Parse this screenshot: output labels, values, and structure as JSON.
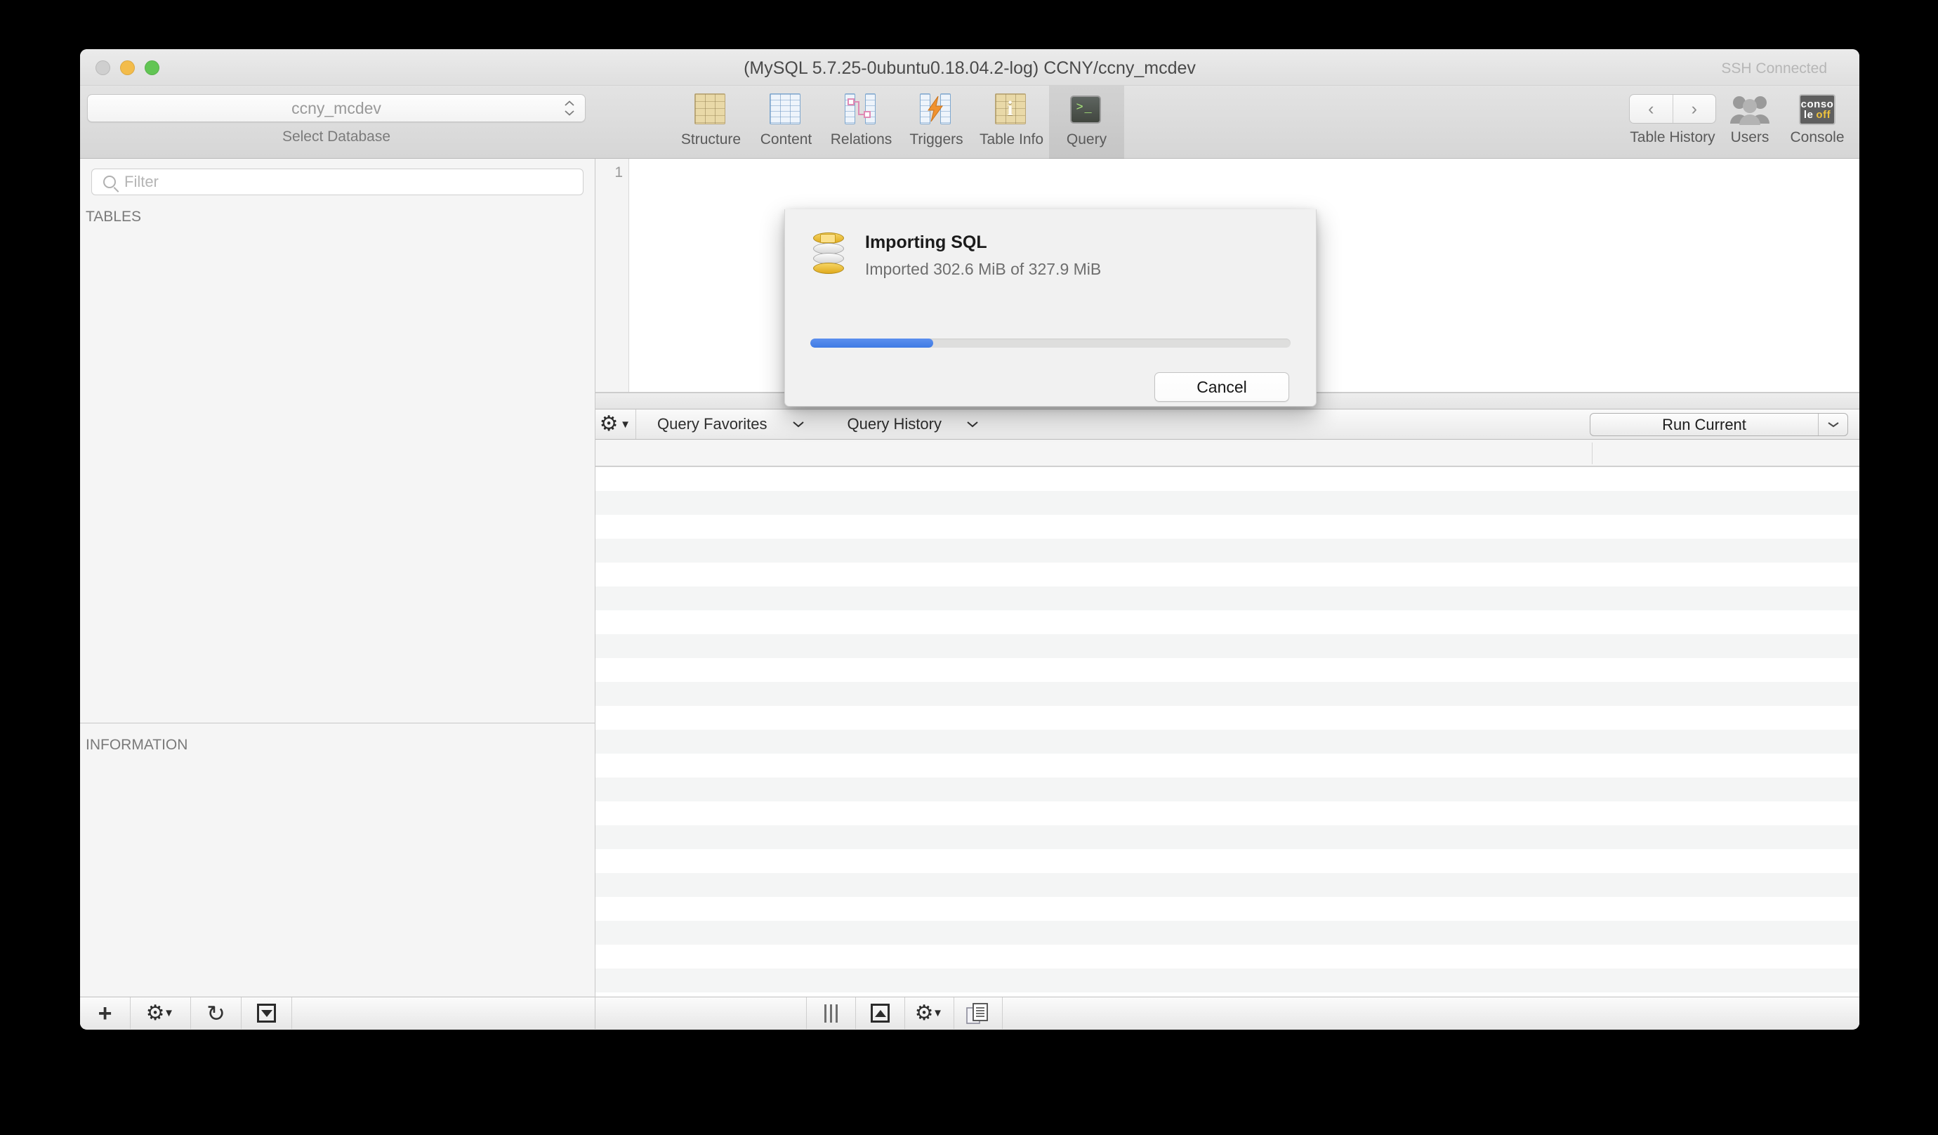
{
  "window": {
    "title": "(MySQL 5.7.25-0ubuntu0.18.04.2-log) CCNY/ccny_mcdev",
    "ssh_status": "SSH Connected"
  },
  "toolbar": {
    "database_selected": "ccny_mcdev",
    "database_sublabel": "Select Database",
    "tabs": [
      {
        "label": "Structure",
        "icon": "structure-icon",
        "selected": false
      },
      {
        "label": "Content",
        "icon": "content-icon",
        "selected": false
      },
      {
        "label": "Relations",
        "icon": "relations-icon",
        "selected": false
      },
      {
        "label": "Triggers",
        "icon": "triggers-icon",
        "selected": false
      },
      {
        "label": "Table Info",
        "icon": "table-info-icon",
        "selected": false
      },
      {
        "label": "Query",
        "icon": "query-icon",
        "selected": true
      }
    ],
    "right_items": [
      {
        "label": "Table History",
        "icon": "back-forward-icon"
      },
      {
        "label": "Users",
        "icon": "users-icon"
      },
      {
        "label": "Console",
        "icon": "console-icon"
      }
    ],
    "console_icon_text": {
      "line1": "conso",
      "line2a": "le",
      "line2b": "off"
    }
  },
  "sidebar": {
    "filter_placeholder": "Filter",
    "filter_value": "",
    "sections": [
      {
        "label": "TABLES",
        "items": []
      },
      {
        "label": "INFORMATION",
        "items": []
      }
    ],
    "bottom_buttons": [
      {
        "icon": "plus-icon",
        "label": "+"
      },
      {
        "icon": "gear-icon",
        "label": "⚙"
      },
      {
        "icon": "refresh-icon",
        "label": "↻"
      },
      {
        "icon": "boxed-triangle-down-icon",
        "label": ""
      }
    ]
  },
  "editor": {
    "line_numbers": [
      "1"
    ],
    "content": ""
  },
  "query_toolbar": {
    "gear_icon": "gear-icon",
    "favorites_label": "Query Favorites",
    "history_label": "Query History",
    "run_label": "Run Current",
    "chevron": "⌄"
  },
  "results": {
    "row_count": 26
  },
  "status_bar": {
    "buttons": [
      {
        "icon": "three-bars-icon"
      },
      {
        "icon": "boxed-triangle-up-icon"
      },
      {
        "icon": "gear-icon"
      },
      {
        "icon": "documents-icon"
      }
    ]
  },
  "sheet": {
    "icon": "database-import-icon",
    "title": "Importing SQL",
    "subtitle": "Imported 302.6 MiB of 327.9 MiB",
    "progress_percent": 25.6,
    "imported": "302.6 MiB",
    "total": "327.9 MiB",
    "cancel_label": "Cancel",
    "accent_color": "#3f7be4"
  }
}
